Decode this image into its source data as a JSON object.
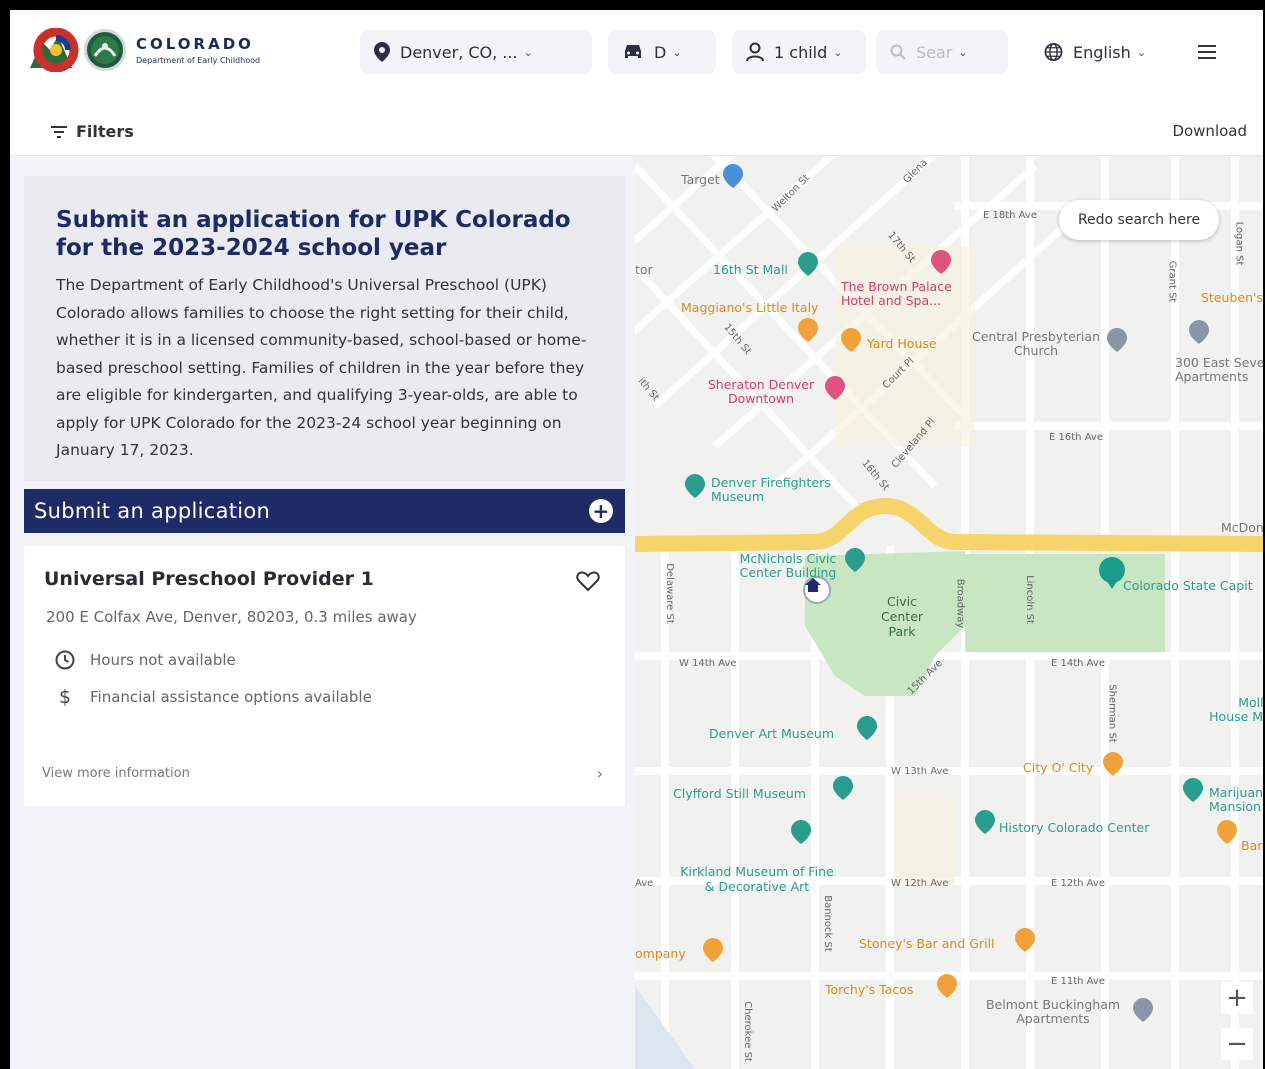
{
  "header": {
    "logo_title": "COLORADO",
    "logo_subtitle": "Department of Early Childhood",
    "location": "Denver, CO, ...",
    "transport": "D",
    "children": "1 child",
    "search_placeholder": "Sear",
    "language": "English"
  },
  "subbar": {
    "filters_label": "Filters",
    "download_label": "Download"
  },
  "promo": {
    "title": "Submit an application for UPK Colorado for the 2023-2024 school year",
    "body": "The Department of Early Childhood's Universal Preschool (UPK) Colorado allows families to choose the right setting for their child, whether it is in a licensed community-based, school-based or home-based preschool setting. Families of children in the year before they are eligible for kindergarten, and qualifying 3-year-olds, are able to apply for UPK Colorado for the 2023-24 school year beginning on January 17, 2023.",
    "apply_label": "Submit an application",
    "apply_icon": "+"
  },
  "provider": {
    "name": "Universal Preschool Provider 1",
    "address": "200 E Colfax Ave, Denver, 80203, 0.3 miles away",
    "hours": "Hours not available",
    "financial": "Financial assistance options available",
    "more_label": "View more information",
    "more_icon": "›"
  },
  "map": {
    "redo_label": "Redo search here",
    "zoom_in": "+",
    "zoom_out": "−",
    "labels": {
      "target": "Target",
      "sixteenth_mall": "16th St Mall",
      "brown_palace": "The Brown Palace Hotel and Spa...",
      "maggianos": "Maggiano's Little Italy",
      "yard_house": "Yard House",
      "central_pres": "Central Presbyterian Church",
      "east_seventh": "300 East Seve Apartments",
      "steubens": "Steuben's",
      "sheraton": "Sheraton Denver Downtown",
      "firefighters": "Denver Firefighters Museum",
      "mcnichols": "McNichols Civic Center Building",
      "civic_park": "Civic Center Park",
      "capitol": "Colorado State Capit",
      "art_museum": "Denver Art Museum",
      "city_o_city": "City O' City",
      "clyfford": "Clyfford Still Museum",
      "history": "History Colorado Center",
      "marijuana": "Marijuana Mansion",
      "molly": "Molly House Mu",
      "kirkland": "Kirkland Museum of Fine & Decorative Art",
      "stoneys": "Stoney's Bar and Grill",
      "torchys": "Torchy's Tacos",
      "belmont": "Belmont Buckingham Apartments",
      "company": "ompany",
      "mcdon": "McDon",
      "bar": "Bar",
      "e18th": "E 18th Ave",
      "e16th": "E 16th Ave",
      "w14th": "W 14th Ave",
      "e14th": "E 14th Ave",
      "w13th": "W 13th Ave",
      "w12th": "W 12th Ave",
      "e12th": "E 12th Ave",
      "e11th": "E 11th Ave",
      "welton": "Welton St",
      "glenarm": "Glena",
      "st17th": "17th St",
      "st15th": "15th St",
      "court": "Court Pl",
      "cleveland": "Cleveland Pl",
      "st16th": "16th St",
      "ave15th": "15th Ave",
      "delaware": "Delaware St",
      "bannock": "Bannock St",
      "broadway": "Broadway",
      "lincoln": "Lincoln St",
      "grant": "Grant St",
      "logan": "Logan St",
      "sherman": "Sherman St",
      "cherokee": "Cherokee St",
      "tor": "tor",
      "ith": "ith St",
      "ave": "Ave"
    }
  },
  "colors": {
    "navy": "#1f2b66",
    "panel_bg": "#f2f3f6",
    "park_green": "#c7e6c1",
    "highway": "#f6d36b",
    "poi_teal": "#2a9d8f"
  }
}
